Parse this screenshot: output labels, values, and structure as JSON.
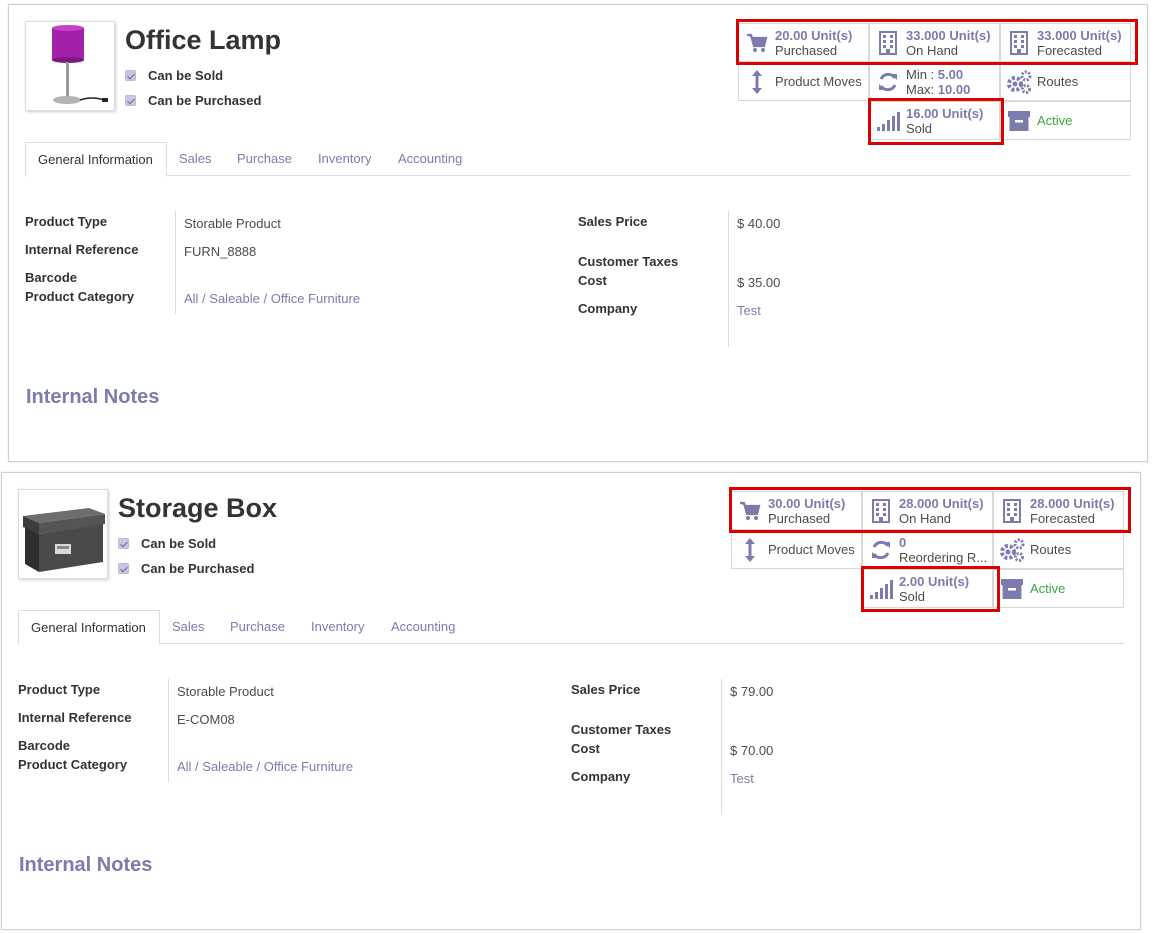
{
  "products": [
    {
      "name": "Office Lamp",
      "can_be_sold": "Can be Sold",
      "can_be_purchased": "Can be Purchased",
      "stats": {
        "purchased": {
          "value": "20.00",
          "unit": "Unit(s)",
          "label": "Purchased",
          "icon": "cart-icon"
        },
        "on_hand": {
          "value": "33.000",
          "unit": "Unit(s)",
          "label": "On Hand",
          "icon": "building-icon"
        },
        "forecasted": {
          "value": "33.000",
          "unit": "Unit(s)",
          "label": "Forecasted",
          "icon": "building-icon"
        },
        "product_moves": {
          "label": "Product Moves",
          "icon": "arrows-vertical-icon"
        },
        "reorder": {
          "line1_label": "Min : ",
          "line1_value": "5.00",
          "line2_label": "Max: ",
          "line2_value": "10.00",
          "icon": "refresh-icon"
        },
        "routes": {
          "label": "Routes",
          "icon": "gears-icon"
        },
        "sold": {
          "value": "16.00",
          "unit": "Unit(s)",
          "label": "Sold",
          "icon": "signal-bars-icon"
        },
        "active": {
          "label": "Active",
          "icon": "archive-icon"
        }
      },
      "tabs": [
        "General Information",
        "Sales",
        "Purchase",
        "Inventory",
        "Accounting"
      ],
      "fields": {
        "product_type": {
          "label": "Product Type",
          "value": "Storable Product"
        },
        "internal_reference": {
          "label": "Internal Reference",
          "value": "FURN_8888"
        },
        "barcode": {
          "label": "Barcode",
          "value": ""
        },
        "product_category": {
          "label": "Product Category",
          "value": "All / Saleable / Office Furniture"
        },
        "sales_price": {
          "label": "Sales Price",
          "value": "$ 40.00"
        },
        "customer_taxes": {
          "label": "Customer Taxes",
          "value": ""
        },
        "cost": {
          "label": "Cost",
          "value": "$ 35.00"
        },
        "company": {
          "label": "Company",
          "value": "Test"
        }
      },
      "internal_notes": "Internal Notes"
    },
    {
      "name": "Storage Box",
      "can_be_sold": "Can be Sold",
      "can_be_purchased": "Can be Purchased",
      "stats": {
        "purchased": {
          "value": "30.00",
          "unit": "Unit(s)",
          "label": "Purchased",
          "icon": "cart-icon"
        },
        "on_hand": {
          "value": "28.000",
          "unit": "Unit(s)",
          "label": "On Hand",
          "icon": "building-icon"
        },
        "forecasted": {
          "value": "28.000",
          "unit": "Unit(s)",
          "label": "Forecasted",
          "icon": "building-icon"
        },
        "product_moves": {
          "label": "Product Moves",
          "icon": "arrows-vertical-icon"
        },
        "reorder": {
          "count": "0",
          "label": "Reordering R...",
          "icon": "refresh-icon"
        },
        "routes": {
          "label": "Routes",
          "icon": "gears-icon"
        },
        "sold": {
          "value": "2.00",
          "unit": "Unit(s)",
          "label": "Sold",
          "icon": "signal-bars-icon"
        },
        "active": {
          "label": "Active",
          "icon": "archive-icon"
        }
      },
      "tabs": [
        "General Information",
        "Sales",
        "Purchase",
        "Inventory",
        "Accounting"
      ],
      "fields": {
        "product_type": {
          "label": "Product Type",
          "value": "Storable Product"
        },
        "internal_reference": {
          "label": "Internal Reference",
          "value": "E-COM08"
        },
        "barcode": {
          "label": "Barcode",
          "value": ""
        },
        "product_category": {
          "label": "Product Category",
          "value": "All / Saleable / Office Furniture"
        },
        "sales_price": {
          "label": "Sales Price",
          "value": "$ 79.00"
        },
        "customer_taxes": {
          "label": "Customer Taxes",
          "value": ""
        },
        "cost": {
          "label": "Cost",
          "value": "$ 70.00"
        },
        "company": {
          "label": "Company",
          "value": "Test"
        }
      },
      "internal_notes": "Internal Notes"
    }
  ],
  "colors": {
    "accent": "#7c7bad",
    "active_green": "#3aa442",
    "highlight_red": "#dd0000",
    "text_dark": "#333333"
  }
}
